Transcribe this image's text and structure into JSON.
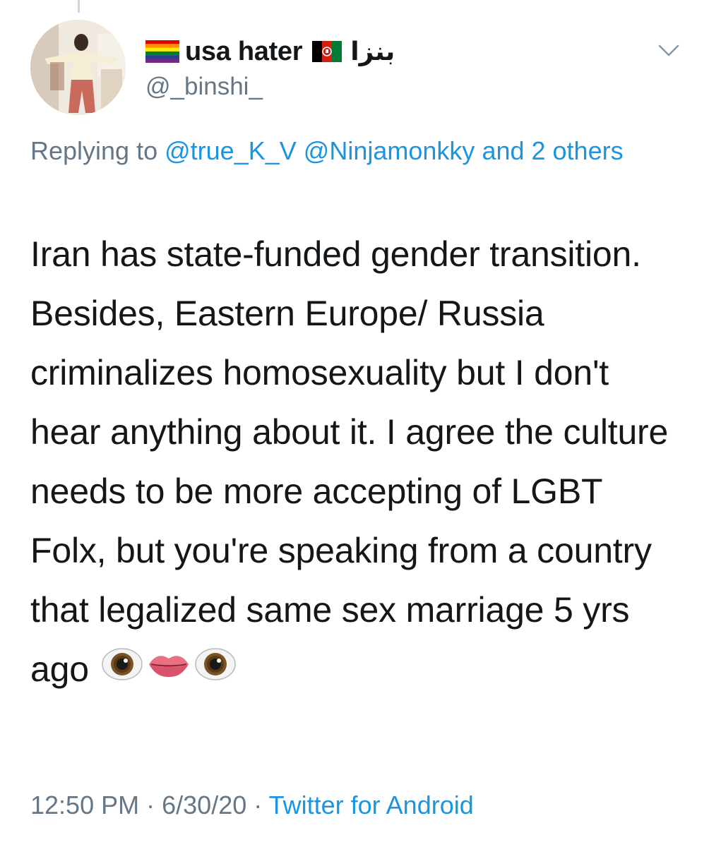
{
  "user": {
    "display_name": "usa hater",
    "name_suffix": "بنزا",
    "handle": "@_binshi_",
    "name_flags": [
      "rainbow-flag-icon",
      "afghanistan-flag-icon"
    ]
  },
  "reply": {
    "prefix": "Replying to",
    "mention_1": "@true_K_V",
    "mention_2": "@Ninjamonkky",
    "others": "and 2 others"
  },
  "tweet": {
    "text": "Iran has state-funded gender transition. Besides, Eastern Europe/ Russia criminalizes homosexuality but I don't hear anything about it. I agree the culture needs to be more accepting of LGBT Folx, but you're speaking from a country that legalized same sex marriage 5 yrs ago",
    "emojis": [
      "eye-emoji-icon",
      "lips-emoji-icon",
      "eye-emoji-icon"
    ]
  },
  "meta": {
    "time": "12:50 PM",
    "separator": "·",
    "date": "6/30/20",
    "source": "Twitter for Android"
  },
  "colors": {
    "link": "#1b95e0",
    "secondary_text": "#657786",
    "primary_text": "#14171a"
  }
}
